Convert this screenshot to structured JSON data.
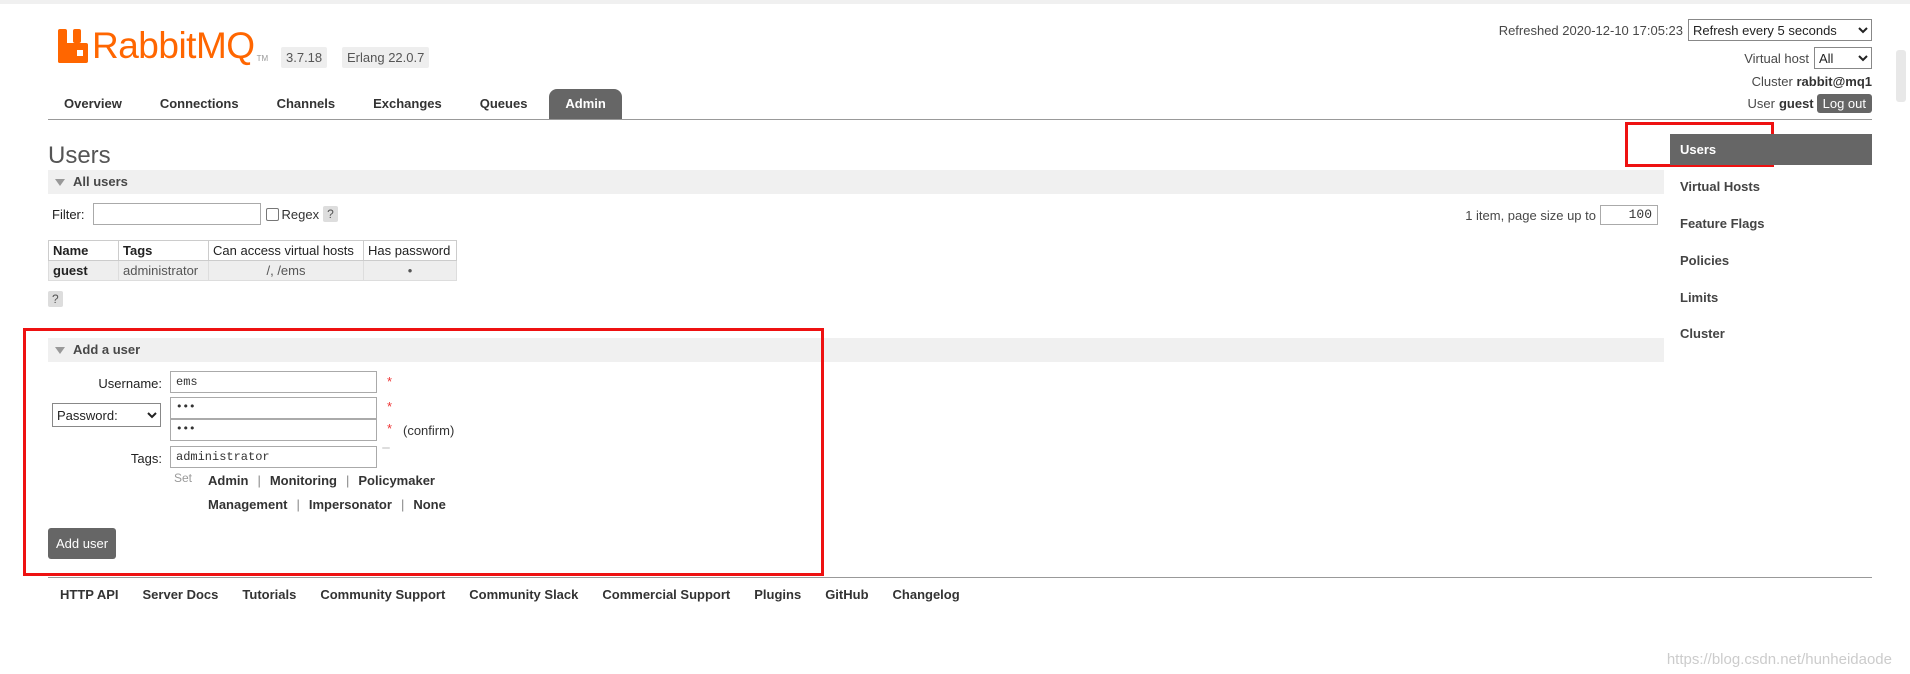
{
  "header": {
    "logo_text": "RabbitMQ",
    "logo_tm": "TM",
    "version": "3.7.18",
    "erlang": "Erlang 22.0.7",
    "refreshed_label": "Refreshed 2020-12-10 17:05:23",
    "refresh_select": "Refresh every 5 seconds",
    "vhost_label": "Virtual host",
    "vhost_select": "All",
    "cluster_label": "Cluster",
    "cluster_value": "rabbit@mq1",
    "user_label": "User",
    "user_value": "guest",
    "logout_label": "Log out"
  },
  "nav": {
    "tabs": [
      "Overview",
      "Connections",
      "Channels",
      "Exchanges",
      "Queues",
      "Admin"
    ],
    "active": "Admin"
  },
  "page": {
    "title": "Users"
  },
  "all_users": {
    "heading": "All users",
    "filter_label": "Filter:",
    "regex_label": "Regex",
    "help": "?",
    "paging_text": "1 item, page size up to",
    "page_size": "100",
    "columns": [
      "Name",
      "Tags",
      "Can access virtual hosts",
      "Has password"
    ],
    "rows": [
      {
        "name": "guest",
        "tags": "administrator",
        "vhosts": "/, /ems",
        "has_password": "•"
      }
    ]
  },
  "add_user": {
    "heading": "Add a user",
    "username_label": "Username:",
    "username_value": "ems",
    "password_select": "Password:",
    "password_mask": "•••",
    "confirm_mask": "•••",
    "required": "*",
    "confirm_label": "(confirm)",
    "tags_label": "Tags:",
    "tags_value": "administrator",
    "set_label": "Set",
    "tag_links": [
      "Admin",
      "Monitoring",
      "Policymaker",
      "Management",
      "Impersonator",
      "None"
    ],
    "sep": "|",
    "button": "Add user"
  },
  "sidebar": {
    "items": [
      "Users",
      "Virtual Hosts",
      "Feature Flags",
      "Policies",
      "Limits",
      "Cluster"
    ],
    "active": "Users"
  },
  "footer": {
    "links": [
      "HTTP API",
      "Server Docs",
      "Tutorials",
      "Community Support",
      "Community Slack",
      "Commercial Support",
      "Plugins",
      "GitHub",
      "Changelog"
    ]
  },
  "watermark": "https://blog.csdn.net/hunheidaode",
  "colors": {
    "brand": "#ff6600",
    "tab_active": "#666666",
    "highlight_box": "#ee1111"
  }
}
